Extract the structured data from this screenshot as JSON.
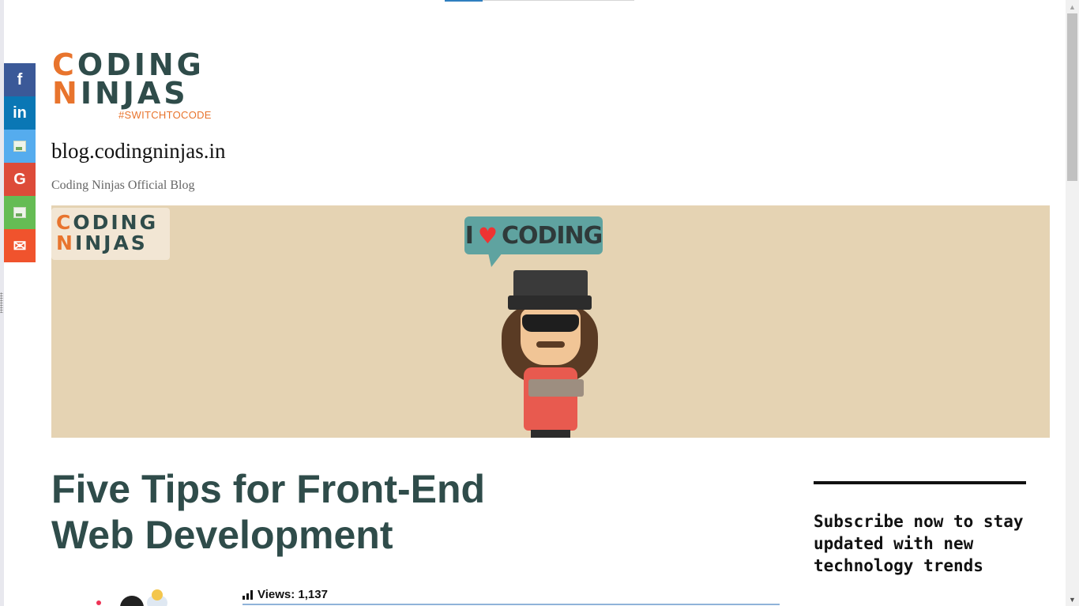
{
  "reading_progress": 0.2,
  "share_bar": {
    "items": [
      {
        "name": "facebook",
        "label": "f",
        "color": "#3b5998"
      },
      {
        "name": "linkedin",
        "label": "in",
        "color": "#0a77b5"
      },
      {
        "name": "twitter",
        "label": "",
        "color": "#55acee"
      },
      {
        "name": "google",
        "label": "G",
        "color": "#dd4b39"
      },
      {
        "name": "whatsapp",
        "label": "",
        "color": "#65bc54"
      },
      {
        "name": "email",
        "label": "✉",
        "color": "#f0532d"
      }
    ]
  },
  "logo": {
    "line1_accent": "C",
    "line1_rest": "ODING",
    "line2_accent": "N",
    "line2_rest": "INJAS",
    "tagline": "#SWITCHTOCODE"
  },
  "site": {
    "title": "blog.codingninjas.in",
    "description": "Coding Ninjas Official Blog"
  },
  "banner": {
    "logo_line1_accent": "C",
    "logo_line1_rest": "ODING",
    "logo_line2_accent": "N",
    "logo_line2_rest": "INJAS",
    "bubble_left": "I",
    "bubble_heart": "♥",
    "bubble_right": "CODING"
  },
  "article": {
    "title": "Five Tips for Front-End Web Development",
    "views_label": "Views: 1,137"
  },
  "sidebar": {
    "widget_title": "Subscribe now to stay updated with new technology trends"
  },
  "colors": {
    "brand_dark": "#2f4c4a",
    "brand_orange": "#e8742d",
    "banner_bg": "#e5d3b3"
  }
}
